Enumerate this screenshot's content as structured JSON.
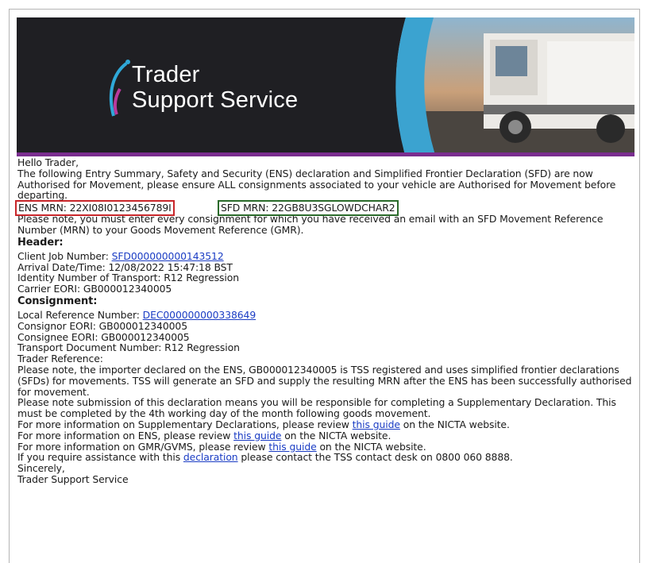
{
  "banner": {
    "logo_line1": "Trader",
    "logo_line2": "Support Service"
  },
  "email": {
    "greeting": "Hello Trader,",
    "intro": "The following Entry Summary, Safety and Security (ENS) declaration and Simplified Frontier Declaration (SFD) are now Authorised for Movement, please ensure ALL consignments associated to your vehicle are Authorised for Movement before departing.",
    "ens_mrn": "ENS MRN: 22XI08I0123456789I",
    "sfd_mrn": "SFD MRN: 22GB8U3SGLOWDCHAR2",
    "note1": "Please note, you must enter every consignment for which you have received an email with an SFD Movement Reference Number (MRN) to your Goods Movement Reference (GMR).",
    "header_title": "Header:",
    "client_job_label": "Client Job Number: ",
    "client_job_value": "SFD000000000143512",
    "arrival": "Arrival Date/Time: 12/08/2022 15:47:18 BST",
    "identity": "Identity Number of Transport: R12 Regression",
    "carrier": "Carrier EORI: GB000012340005",
    "consignment_title": "Consignment:",
    "lrn_label": "Local Reference Number: ",
    "lrn_value": "DEC000000000338649",
    "consignor": "Consignor EORI: GB000012340005",
    "consignee": "Consignee EORI: GB000012340005",
    "transport_doc": "Transport Document Number: R12 Regression",
    "trader_ref": "Trader Reference:",
    "note2": "Please note, the importer declared on the ENS, GB000012340005 is TSS registered and uses simplified frontier declarations (SFDs) for movements. TSS will generate an SFD and supply the resulting MRN after the ENS has been successfully authorised for movement.",
    "note3": "Please note submission of this declaration means you will be responsible for completing a Supplementary Declaration. This must be completed by the 4th working day of the month following goods movement.",
    "info_sd_pre": "For more information on Supplementary Declarations, please review ",
    "info_sd_link": "this guide",
    "info_sd_post": " on the NICTA website.",
    "info_ens_pre": "For more information on ENS, please review ",
    "info_ens_link": "this guide",
    "info_ens_post": " on the NICTA website.",
    "info_gmr_pre": "For more information on GMR/GVMS, please review ",
    "info_gmr_link": "this guide",
    "info_gmr_post": " on the NICTA website.",
    "assist_pre": "If you require assistance with this ",
    "assist_link": "declaration",
    "assist_post": " please contact the TSS contact desk on 0800 060 8888.",
    "signoff": "Sincerely,",
    "signature": "Trader Support Service"
  }
}
